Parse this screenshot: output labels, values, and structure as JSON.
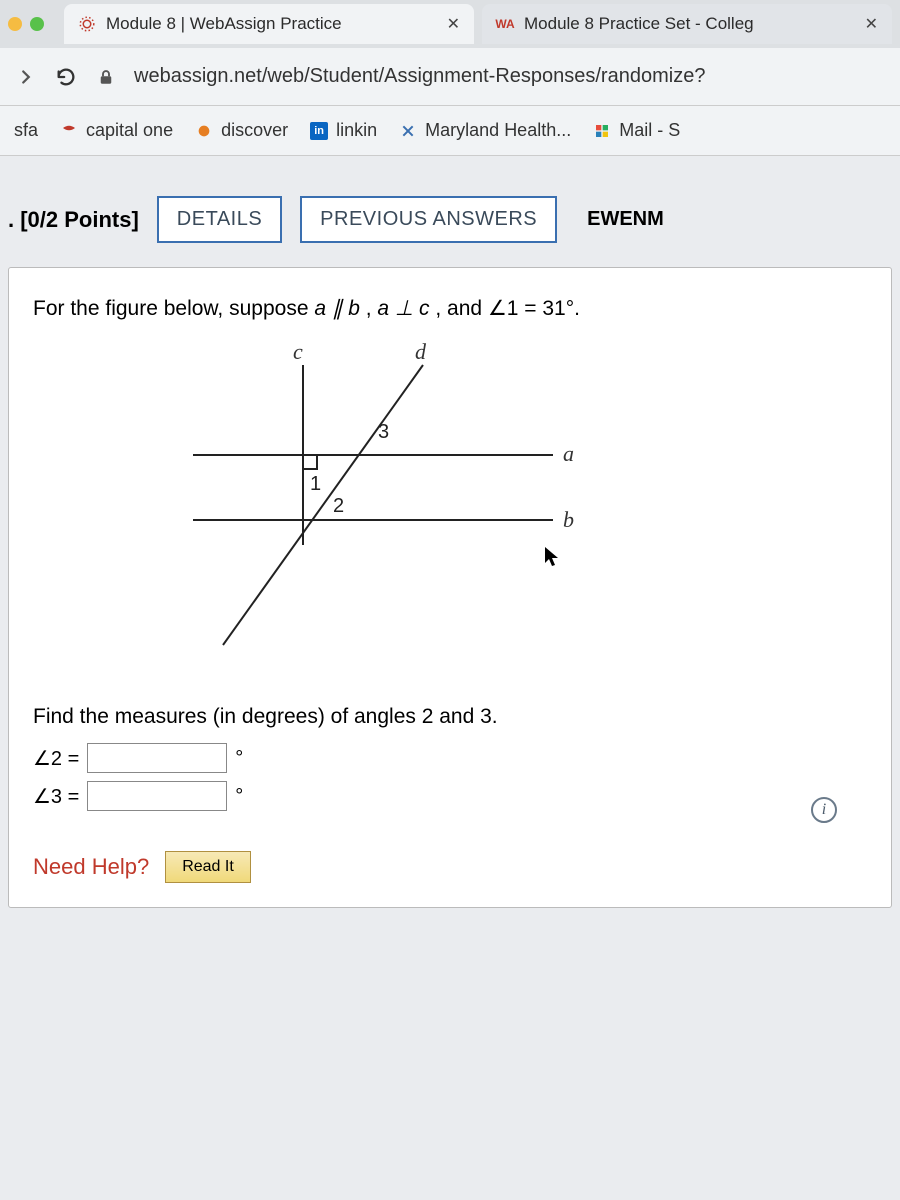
{
  "tabs": [
    {
      "title": "Module 8 | WebAssign Practice"
    },
    {
      "title": "Module 8 Practice Set - Colleg"
    }
  ],
  "url": "webassign.net/web/Student/Assignment-Responses/randomize?",
  "bookmarks": {
    "folder": "sfa",
    "items": [
      "capital one",
      "discover",
      "linkin",
      "Maryland Health...",
      "Mail - S"
    ]
  },
  "question": {
    "number_label": ". [0/2 Points]",
    "details_btn": "DETAILS",
    "prev_btn": "PREVIOUS ANSWERS",
    "source": "EWENM",
    "prompt_prefix": "For the figure below, suppose ",
    "prompt_ab": "a ∥ b",
    "prompt_sep1": ", ",
    "prompt_ac": "a ⊥ c",
    "prompt_sep2": ", and ",
    "prompt_angle": "∠1 = 31°.",
    "figure_labels": {
      "c": "c",
      "d": "d",
      "a": "a",
      "b": "b",
      "n1": "1",
      "n2": "2",
      "n3": "3"
    },
    "find_text": "Find the measures (in degrees) of angles 2 and 3.",
    "angle2_label": "∠2  =",
    "angle3_label": "∠3  =",
    "deg": "°",
    "help_label": "Need Help?",
    "read_btn": "Read It",
    "info": "i"
  }
}
